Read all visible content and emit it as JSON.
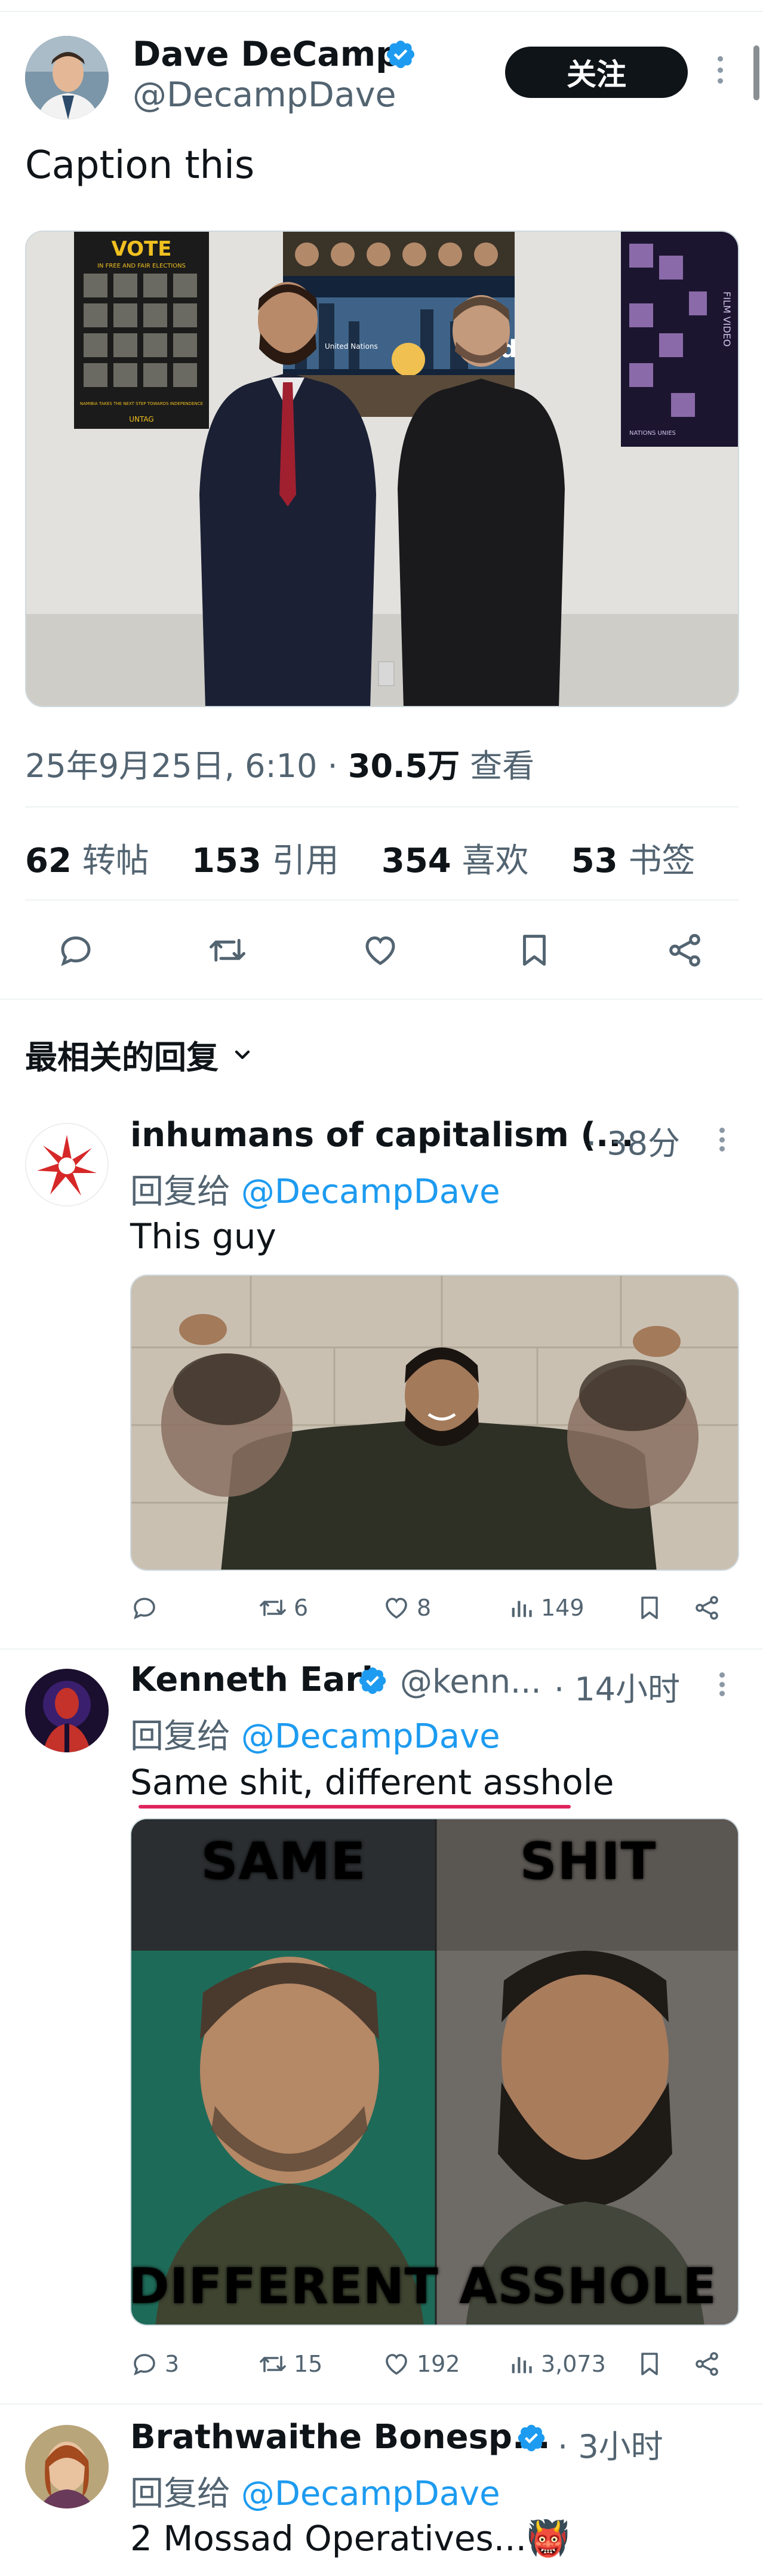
{
  "tweet": {
    "author_name": "Dave DeCamp",
    "author_handle": "@DecampDave",
    "follow_label": "关注",
    "text": "Caption this",
    "photo": {
      "poster_left_title": "VOTE",
      "poster_left_sub": "IN FREE AND FAIR ELECTIONS",
      "poster_left_foot": "NAMIBIA TAKES THE NEXT STEP TOWARDS INDEPENDENCE",
      "poster_left_org": "UNTAG",
      "poster_center_text": "United Nations",
      "poster_center_world": "rld",
      "poster_right_text": "FILM VIDEO",
      "poster_right_foot": "NATIONS UNIES"
    },
    "date_time": "25年9月25日, 6:10",
    "separator": "·",
    "views_count": "30.5万",
    "views_label": "查看",
    "stats": [
      {
        "num": "62",
        "label": "转帖"
      },
      {
        "num": "153",
        "label": "引用"
      },
      {
        "num": "354",
        "label": "喜欢"
      },
      {
        "num": "53",
        "label": "书签"
      }
    ]
  },
  "sort_label": "最相关的回复",
  "replies": [
    {
      "name": "inhumans of capitalism (...",
      "handle": "",
      "time": "· 38分",
      "reply_prefix": "回复给",
      "reply_to": "@DecampDave",
      "text": "This guy",
      "counts": {
        "reply": "",
        "retweet": "6",
        "like": "8",
        "views": "149"
      }
    },
    {
      "name": "Kenneth Earl",
      "handle": "@kenn...",
      "time": "· 14小时",
      "reply_prefix": "回复给",
      "reply_to": "@DecampDave",
      "text": "Same shit, different asshole",
      "meme": {
        "top_left": "SAME",
        "top_right": "SHIT",
        "bottom_left": "DIFFERENT",
        "bottom_right": "ASSHOLE"
      },
      "counts": {
        "reply": "3",
        "retweet": "15",
        "like": "192",
        "views": "3,073"
      }
    },
    {
      "name": "Brathwaithe Bonesp...",
      "handle": "",
      "time": "· 3小时",
      "reply_prefix": "回复给",
      "reply_to": "@DecampDave",
      "text": "2 Mossad Operatives...👹"
    }
  ],
  "colors": {
    "accent": "#1d9bf0",
    "text": "#0f1419",
    "muted": "#536471",
    "divider": "#eff3f4",
    "underline": "#e0245e"
  }
}
